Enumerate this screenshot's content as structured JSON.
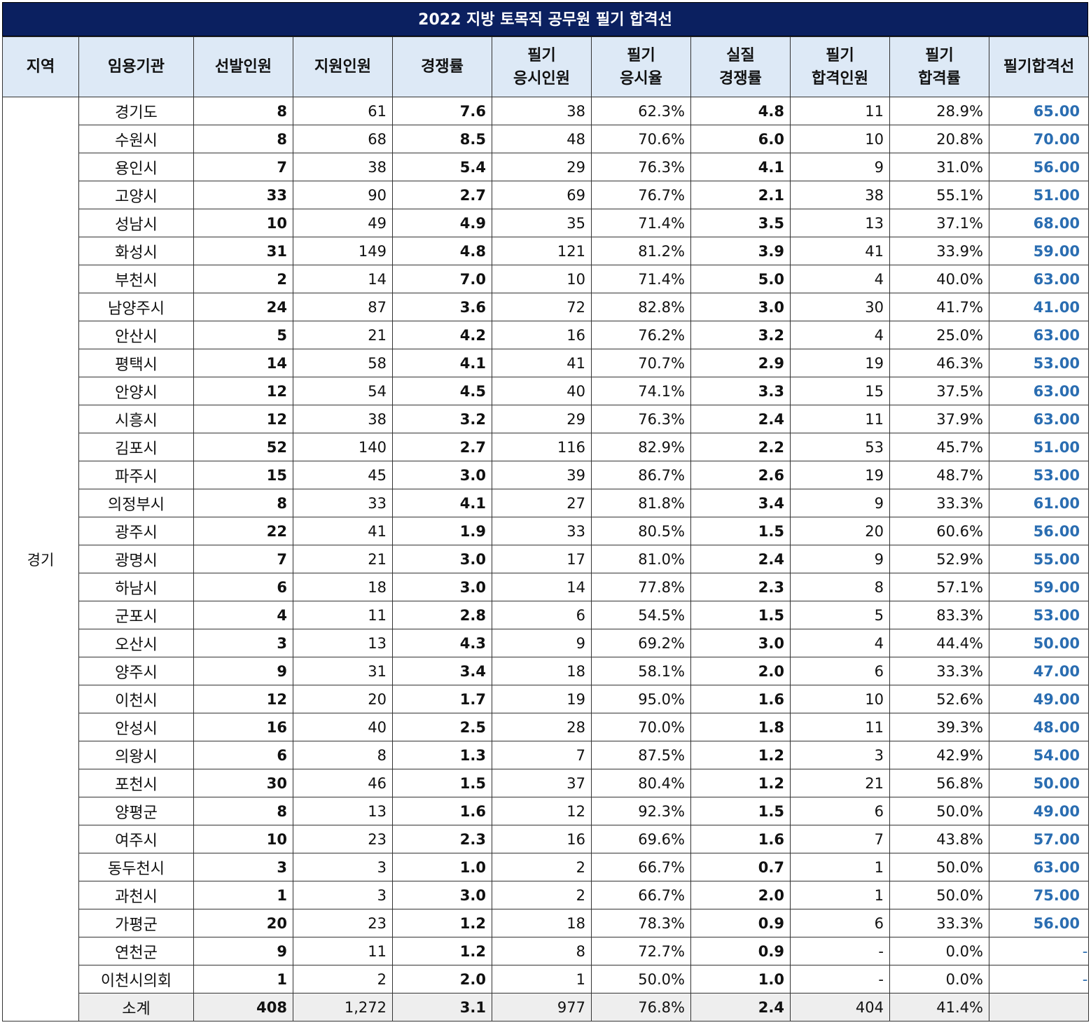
{
  "title": "2022 지방 토목직 공무원 필기 합격선",
  "headers": {
    "region": "지역",
    "org": "임용기관",
    "selected": "선발인원",
    "applicants": "지원인원",
    "competition": "경쟁률",
    "taker_1": "필기",
    "taker_2": "응시인원",
    "rate_1": "필기",
    "rate_2": "응시율",
    "real_1": "실질",
    "real_2": "경쟁률",
    "pass_1": "필기",
    "pass_2": "합격인원",
    "prate_1": "필기",
    "prate_2": "합격률",
    "cutoff": "필기합격선"
  },
  "region": "경기",
  "rows": [
    {
      "org": "경기도",
      "sel": "8",
      "app": "61",
      "comp": "7.6",
      "take": "38",
      "trate": "62.3%",
      "real": "4.8",
      "pass": "11",
      "prate": "28.9%",
      "cut": "65.00"
    },
    {
      "org": "수원시",
      "sel": "8",
      "app": "68",
      "comp": "8.5",
      "take": "48",
      "trate": "70.6%",
      "real": "6.0",
      "pass": "10",
      "prate": "20.8%",
      "cut": "70.00"
    },
    {
      "org": "용인시",
      "sel": "7",
      "app": "38",
      "comp": "5.4",
      "take": "29",
      "trate": "76.3%",
      "real": "4.1",
      "pass": "9",
      "prate": "31.0%",
      "cut": "56.00"
    },
    {
      "org": "고양시",
      "sel": "33",
      "app": "90",
      "comp": "2.7",
      "take": "69",
      "trate": "76.7%",
      "real": "2.1",
      "pass": "38",
      "prate": "55.1%",
      "cut": "51.00"
    },
    {
      "org": "성남시",
      "sel": "10",
      "app": "49",
      "comp": "4.9",
      "take": "35",
      "trate": "71.4%",
      "real": "3.5",
      "pass": "13",
      "prate": "37.1%",
      "cut": "68.00"
    },
    {
      "org": "화성시",
      "sel": "31",
      "app": "149",
      "comp": "4.8",
      "take": "121",
      "trate": "81.2%",
      "real": "3.9",
      "pass": "41",
      "prate": "33.9%",
      "cut": "59.00"
    },
    {
      "org": "부천시",
      "sel": "2",
      "app": "14",
      "comp": "7.0",
      "take": "10",
      "trate": "71.4%",
      "real": "5.0",
      "pass": "4",
      "prate": "40.0%",
      "cut": "63.00"
    },
    {
      "org": "남양주시",
      "sel": "24",
      "app": "87",
      "comp": "3.6",
      "take": "72",
      "trate": "82.8%",
      "real": "3.0",
      "pass": "30",
      "prate": "41.7%",
      "cut": "41.00"
    },
    {
      "org": "안산시",
      "sel": "5",
      "app": "21",
      "comp": "4.2",
      "take": "16",
      "trate": "76.2%",
      "real": "3.2",
      "pass": "4",
      "prate": "25.0%",
      "cut": "63.00"
    },
    {
      "org": "평택시",
      "sel": "14",
      "app": "58",
      "comp": "4.1",
      "take": "41",
      "trate": "70.7%",
      "real": "2.9",
      "pass": "19",
      "prate": "46.3%",
      "cut": "53.00"
    },
    {
      "org": "안양시",
      "sel": "12",
      "app": "54",
      "comp": "4.5",
      "take": "40",
      "trate": "74.1%",
      "real": "3.3",
      "pass": "15",
      "prate": "37.5%",
      "cut": "63.00"
    },
    {
      "org": "시흥시",
      "sel": "12",
      "app": "38",
      "comp": "3.2",
      "take": "29",
      "trate": "76.3%",
      "real": "2.4",
      "pass": "11",
      "prate": "37.9%",
      "cut": "63.00"
    },
    {
      "org": "김포시",
      "sel": "52",
      "app": "140",
      "comp": "2.7",
      "take": "116",
      "trate": "82.9%",
      "real": "2.2",
      "pass": "53",
      "prate": "45.7%",
      "cut": "51.00"
    },
    {
      "org": "파주시",
      "sel": "15",
      "app": "45",
      "comp": "3.0",
      "take": "39",
      "trate": "86.7%",
      "real": "2.6",
      "pass": "19",
      "prate": "48.7%",
      "cut": "53.00"
    },
    {
      "org": "의정부시",
      "sel": "8",
      "app": "33",
      "comp": "4.1",
      "take": "27",
      "trate": "81.8%",
      "real": "3.4",
      "pass": "9",
      "prate": "33.3%",
      "cut": "61.00"
    },
    {
      "org": "광주시",
      "sel": "22",
      "app": "41",
      "comp": "1.9",
      "take": "33",
      "trate": "80.5%",
      "real": "1.5",
      "pass": "20",
      "prate": "60.6%",
      "cut": "56.00"
    },
    {
      "org": "광명시",
      "sel": "7",
      "app": "21",
      "comp": "3.0",
      "take": "17",
      "trate": "81.0%",
      "real": "2.4",
      "pass": "9",
      "prate": "52.9%",
      "cut": "55.00"
    },
    {
      "org": "하남시",
      "sel": "6",
      "app": "18",
      "comp": "3.0",
      "take": "14",
      "trate": "77.8%",
      "real": "2.3",
      "pass": "8",
      "prate": "57.1%",
      "cut": "59.00"
    },
    {
      "org": "군포시",
      "sel": "4",
      "app": "11",
      "comp": "2.8",
      "take": "6",
      "trate": "54.5%",
      "real": "1.5",
      "pass": "5",
      "prate": "83.3%",
      "cut": "53.00"
    },
    {
      "org": "오산시",
      "sel": "3",
      "app": "13",
      "comp": "4.3",
      "take": "9",
      "trate": "69.2%",
      "real": "3.0",
      "pass": "4",
      "prate": "44.4%",
      "cut": "50.00"
    },
    {
      "org": "양주시",
      "sel": "9",
      "app": "31",
      "comp": "3.4",
      "take": "18",
      "trate": "58.1%",
      "real": "2.0",
      "pass": "6",
      "prate": "33.3%",
      "cut": "47.00"
    },
    {
      "org": "이천시",
      "sel": "12",
      "app": "20",
      "comp": "1.7",
      "take": "19",
      "trate": "95.0%",
      "real": "1.6",
      "pass": "10",
      "prate": "52.6%",
      "cut": "49.00"
    },
    {
      "org": "안성시",
      "sel": "16",
      "app": "40",
      "comp": "2.5",
      "take": "28",
      "trate": "70.0%",
      "real": "1.8",
      "pass": "11",
      "prate": "39.3%",
      "cut": "48.00"
    },
    {
      "org": "의왕시",
      "sel": "6",
      "app": "8",
      "comp": "1.3",
      "take": "7",
      "trate": "87.5%",
      "real": "1.2",
      "pass": "3",
      "prate": "42.9%",
      "cut": "54.00"
    },
    {
      "org": "포천시",
      "sel": "30",
      "app": "46",
      "comp": "1.5",
      "take": "37",
      "trate": "80.4%",
      "real": "1.2",
      "pass": "21",
      "prate": "56.8%",
      "cut": "50.00"
    },
    {
      "org": "양평군",
      "sel": "8",
      "app": "13",
      "comp": "1.6",
      "take": "12",
      "trate": "92.3%",
      "real": "1.5",
      "pass": "6",
      "prate": "50.0%",
      "cut": "49.00"
    },
    {
      "org": "여주시",
      "sel": "10",
      "app": "23",
      "comp": "2.3",
      "take": "16",
      "trate": "69.6%",
      "real": "1.6",
      "pass": "7",
      "prate": "43.8%",
      "cut": "57.00"
    },
    {
      "org": "동두천시",
      "sel": "3",
      "app": "3",
      "comp": "1.0",
      "take": "2",
      "trate": "66.7%",
      "real": "0.7",
      "pass": "1",
      "prate": "50.0%",
      "cut": "63.00"
    },
    {
      "org": "과천시",
      "sel": "1",
      "app": "3",
      "comp": "3.0",
      "take": "2",
      "trate": "66.7%",
      "real": "2.0",
      "pass": "1",
      "prate": "50.0%",
      "cut": "75.00"
    },
    {
      "org": "가평군",
      "sel": "20",
      "app": "23",
      "comp": "1.2",
      "take": "18",
      "trate": "78.3%",
      "real": "0.9",
      "pass": "6",
      "prate": "33.3%",
      "cut": "56.00"
    },
    {
      "org": "연천군",
      "sel": "9",
      "app": "11",
      "comp": "1.2",
      "take": "8",
      "trate": "72.7%",
      "real": "0.9",
      "pass": "-",
      "prate": "0.0%",
      "cut": "-"
    },
    {
      "org": "이천시의회",
      "sel": "1",
      "app": "2",
      "comp": "2.0",
      "take": "1",
      "trate": "50.0%",
      "real": "1.0",
      "pass": "-",
      "prate": "0.0%",
      "cut": "-"
    }
  ],
  "subtotal": {
    "org": "소계",
    "sel": "408",
    "app": "1,272",
    "comp": "3.1",
    "take": "977",
    "trate": "76.8%",
    "real": "2.4",
    "pass": "404",
    "prate": "41.4%",
    "cut": ""
  }
}
